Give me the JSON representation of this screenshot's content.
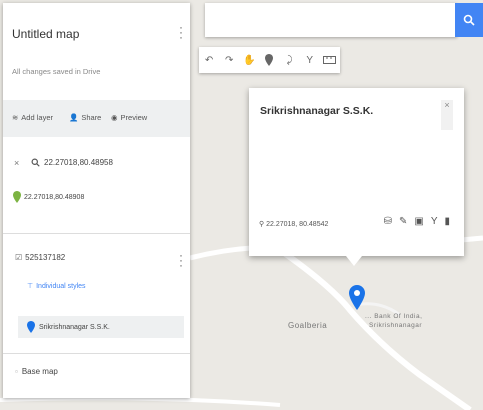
{
  "map": {
    "place_label": "Goalberia",
    "poi_label_line1": "... Bank Of India,",
    "poi_label_line2": "Srikrishnanagar"
  },
  "panel": {
    "title": "Untitled map",
    "saved_status": "All changes saved in Drive",
    "actions": {
      "add_layer": "Add layer",
      "share": "Share",
      "preview": "Preview"
    },
    "search_result": {
      "query": "22.27018,80.48958",
      "point": "22.27018,80.48908"
    },
    "layer": {
      "name": "525137182",
      "style_label": "Individual styles",
      "item": "Srikrishnanagar S.S.K."
    },
    "base_map_label": "Base map"
  },
  "popup": {
    "title": "Srikrishnanagar S.S.K.",
    "coords": "22.27018, 80.48542"
  },
  "colors": {
    "accent": "#4285f4",
    "pin_blue": "#1a73e8",
    "pin_green": "#7cb342"
  }
}
